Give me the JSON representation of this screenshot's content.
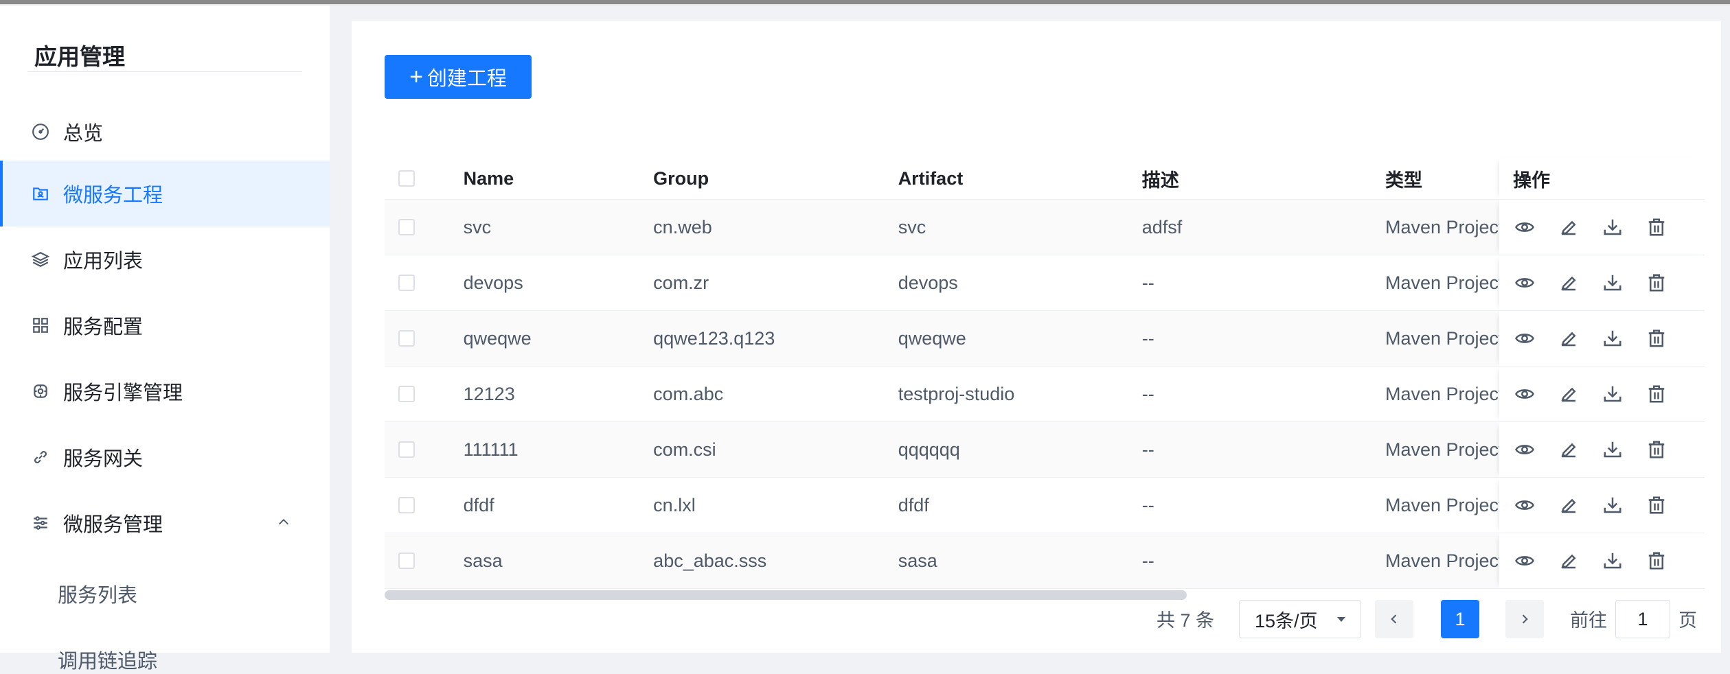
{
  "sidebar": {
    "title": "应用管理",
    "items": [
      {
        "label": "总览",
        "icon": "dashboard-icon"
      },
      {
        "label": "微服务工程",
        "icon": "folder-user-icon",
        "active": true
      },
      {
        "label": "应用列表",
        "icon": "layers-icon"
      },
      {
        "label": "服务配置",
        "icon": "grid-icon"
      },
      {
        "label": "服务引擎管理",
        "icon": "engine-icon"
      },
      {
        "label": "服务网关",
        "icon": "link-icon"
      },
      {
        "label": "微服务管理",
        "icon": "sliders-icon",
        "expanded": true
      }
    ],
    "sub_items": [
      "服务列表",
      "调用链追踪"
    ]
  },
  "toolbar": {
    "create_label": "创建工程",
    "create_icon": "plus-icon"
  },
  "table": {
    "columns": [
      "Name",
      "Group",
      "Artifact",
      "描述",
      "类型",
      "操作"
    ],
    "rows": [
      {
        "name": "svc",
        "group": "cn.web",
        "artifact": "svc",
        "desc": "adfsf",
        "type": "Maven Project"
      },
      {
        "name": "devops",
        "group": "com.zr",
        "artifact": "devops",
        "desc": "--",
        "type": "Maven Project"
      },
      {
        "name": "qweqwe",
        "group": "qqwe123.q123",
        "artifact": "qweqwe",
        "desc": "--",
        "type": "Maven Project"
      },
      {
        "name": "12123",
        "group": "com.abc",
        "artifact": "testproj-studio",
        "desc": "--",
        "type": "Maven Project"
      },
      {
        "name": "111111",
        "group": "com.csi",
        "artifact": "qqqqqq",
        "desc": "--",
        "type": "Maven Project"
      },
      {
        "name": "dfdf",
        "group": "cn.lxl",
        "artifact": "dfdf",
        "desc": "--",
        "type": "Maven Project"
      },
      {
        "name": "sasa",
        "group": "abc_abac.sss",
        "artifact": "sasa",
        "desc": "--",
        "type": "Maven Project"
      }
    ],
    "row_actions": [
      "eye-icon",
      "edit-icon",
      "download-icon",
      "delete-icon"
    ]
  },
  "pagination": {
    "total": "共 7 条",
    "page_size": "15条/页",
    "current_page": "1",
    "goto_label": "前往",
    "goto_value": "1",
    "page_suffix": "页"
  },
  "colors": {
    "accent": "#1677ff",
    "active_bg": "#e8f3ff"
  }
}
